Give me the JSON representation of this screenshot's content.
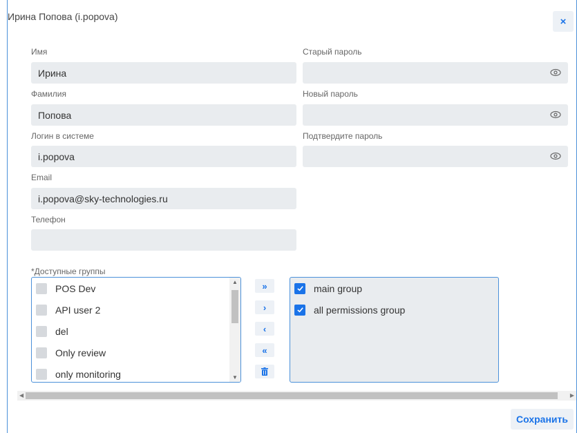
{
  "dialog": {
    "title": "Ирина Попова (i.popova)",
    "close_label": "×"
  },
  "form": {
    "first_name": {
      "label": "Имя",
      "value": "Ирина"
    },
    "last_name": {
      "label": "Фамилия",
      "value": "Попова"
    },
    "login": {
      "label": "Логин в системе",
      "value": "i.popova"
    },
    "email": {
      "label": "Email",
      "value": "i.popova@sky-technologies.ru"
    },
    "phone": {
      "label": "Телефон",
      "value": ""
    },
    "old_password": {
      "label": "Старый пароль",
      "value": ""
    },
    "new_password": {
      "label": "Новый пароль",
      "value": ""
    },
    "confirm_password": {
      "label": "Подтвердите пароль",
      "value": ""
    }
  },
  "groups": {
    "label": "*Доступные группы",
    "available": [
      "POS Dev",
      "API user 2",
      "del",
      "Only review",
      "only monitoring"
    ],
    "selected": [
      "main group",
      "all permissions group"
    ],
    "buttons": {
      "move_all_right": "»",
      "move_right": "›",
      "move_left": "‹",
      "move_all_left": "«"
    }
  },
  "footer": {
    "save_label": "Сохранить"
  },
  "colors": {
    "accent": "#1a73e8",
    "field_bg": "#e9ecef",
    "border": "#4a90d9"
  }
}
